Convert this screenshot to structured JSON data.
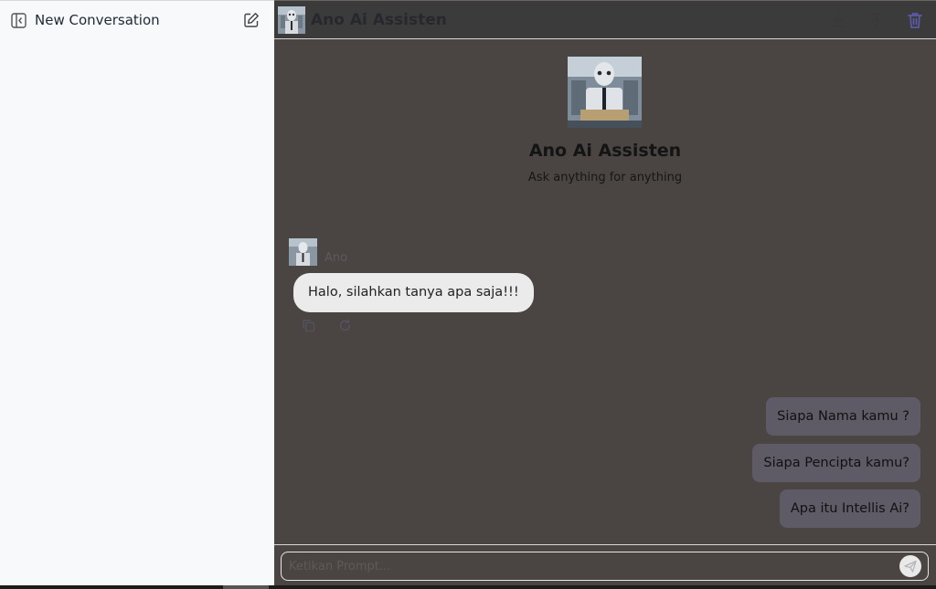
{
  "sidebar": {
    "title": "New Conversation",
    "collapse_icon": "sidebar-collapse-icon",
    "new_chat_icon": "edit-icon"
  },
  "header": {
    "title": "Ano Ai Assisten",
    "actions": [
      "download-icon",
      "upload-icon",
      "trash-icon"
    ]
  },
  "hero": {
    "title": "Ano Ai Assisten",
    "subtitle": "Ask anything for anything"
  },
  "messages": [
    {
      "sender": "Ano",
      "text": "Halo, silahkan tanya apa saja!!!"
    }
  ],
  "message_actions": [
    "copy-icon",
    "regenerate-icon"
  ],
  "suggestions": [
    "Siapa Nama kamu ?",
    "Siapa Pencipta kamu?",
    "Apa itu Intellis Ai?"
  ],
  "input": {
    "placeholder": "Ketikan Prompt...",
    "value": ""
  },
  "colors": {
    "main_bg": "#4a4543",
    "topbar_bg": "#3c3b3b",
    "sidebar_bg": "#f8f9fb",
    "suggestion_bg": "#5e5a66",
    "bubble_bg": "#ebebeb",
    "trash_icon": "#5b5aa8"
  }
}
